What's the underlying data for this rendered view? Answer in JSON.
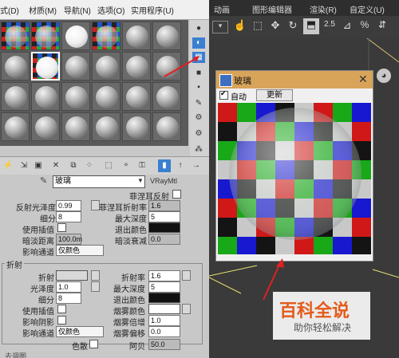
{
  "material_editor": {
    "menu": [
      "式(D)",
      "材质(M)",
      "导航(N)",
      "选项(O)",
      "实用程序(U)"
    ],
    "material_name": "玻璃",
    "material_type": "VRayMtl",
    "reflect_section": {
      "rows": [
        {
          "label": "反射光泽度",
          "value": "0.99"
        },
        {
          "label": "细分",
          "value": "8"
        },
        {
          "label": "使用插值",
          "value": ""
        },
        {
          "label": "暗淡距离",
          "value": "100.0m"
        },
        {
          "label": "影响通道",
          "value": "仅颜色"
        }
      ],
      "right_rows": [
        {
          "label": "菲涅耳反射",
          "value": ""
        },
        {
          "label": "菲涅耳折射率",
          "value": "1.6"
        },
        {
          "label": "最大深度",
          "value": "5"
        },
        {
          "label": "退出颜色",
          "value": ""
        },
        {
          "label": "暗淡衰减",
          "value": "0.0"
        }
      ]
    },
    "refract_section": {
      "title": "折射",
      "left_rows": [
        {
          "label": "折射",
          "value": ""
        },
        {
          "label": "光泽度",
          "value": "1.0"
        },
        {
          "label": "细分",
          "value": "8"
        },
        {
          "label": "使用插值",
          "value": ""
        },
        {
          "label": "影响阴影",
          "value": ""
        },
        {
          "label": "影响通道",
          "value": "仅颜色"
        },
        {
          "label": "色散",
          "value": ""
        }
      ],
      "right_rows": [
        {
          "label": "折射率",
          "value": "1.6"
        },
        {
          "label": "最大深度",
          "value": "5"
        },
        {
          "label": "退出颜色",
          "value": ""
        },
        {
          "label": "烟雾颜色",
          "value": ""
        },
        {
          "label": "烟雾倍增",
          "value": "1.0"
        },
        {
          "label": "烟雾偏移",
          "value": "0.0"
        },
        {
          "label": "阿贝",
          "value": "50.0"
        }
      ]
    },
    "bottom_label": "去调图"
  },
  "main_menu": [
    "动画",
    "图形编辑器",
    "渲染(R)",
    "自定义(U)"
  ],
  "main_toolbar": {
    "zoom_label": "2.5"
  },
  "preview_window": {
    "title": "玻璃",
    "auto_label": "自动",
    "update_label": "更新"
  },
  "watermark": {
    "title": "百科全说",
    "subtitle": "助你轻松解决"
  },
  "colors": {
    "accent_blue": "#3a7fd0",
    "annotation_red": "#e02020",
    "preview_title_bg": "#d8a45a",
    "checker": [
      "#d01818",
      "#18a818",
      "#1818d0",
      "#141414",
      "#c8c8c8"
    ]
  }
}
